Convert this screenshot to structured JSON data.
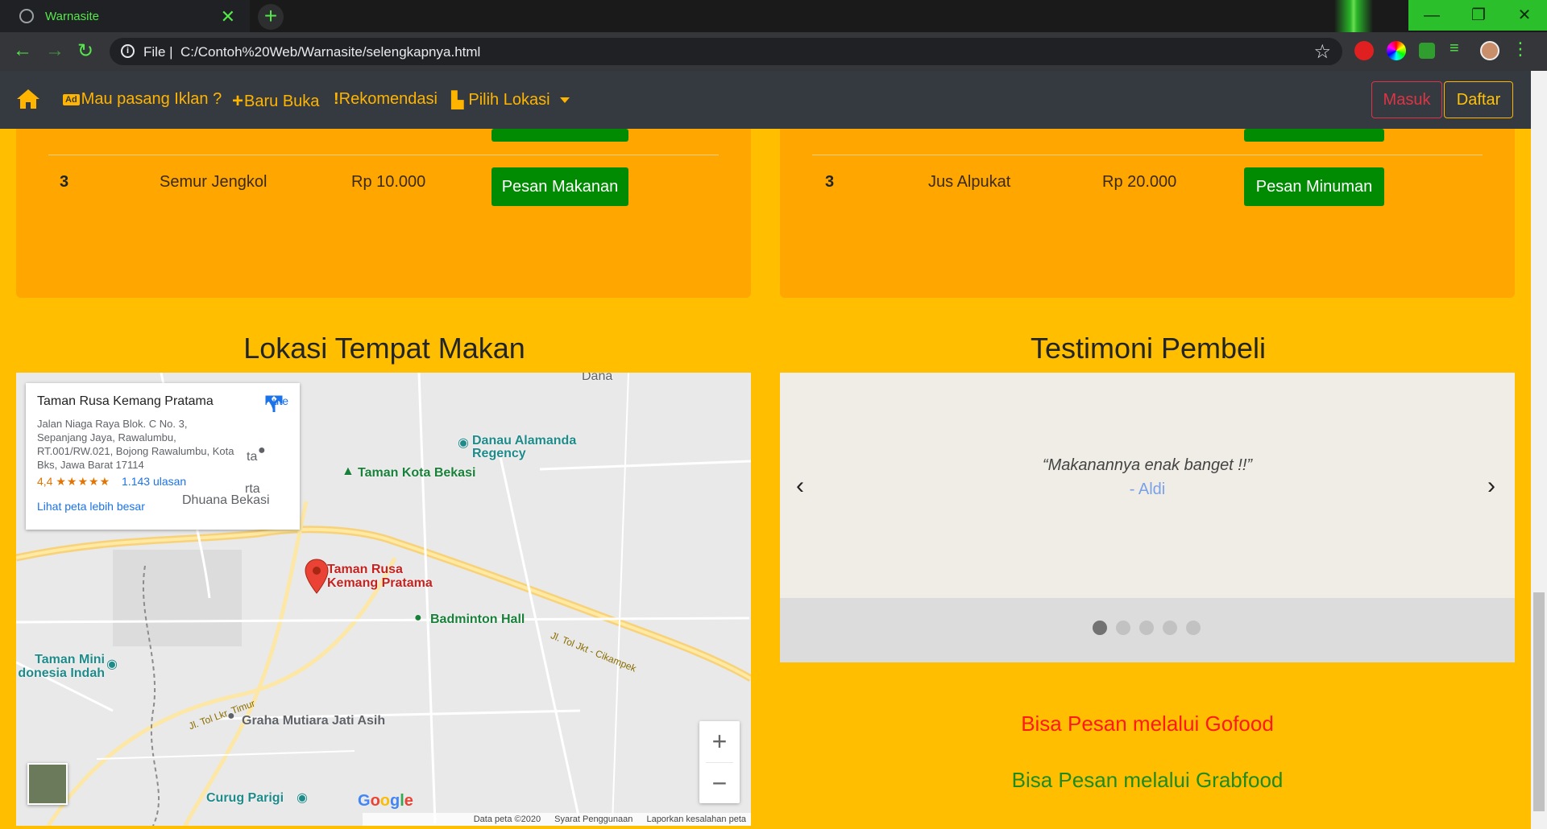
{
  "browser": {
    "tab_title": "Warnasite",
    "tab_close": "✕",
    "new_tab": "+",
    "scheme": "File  |",
    "url": "C:/Contoh%20Web/Warnasite/selengkapnya.html",
    "window_buttons": [
      "—",
      "❐",
      "✕"
    ]
  },
  "navbar": {
    "ad_badge": "Ad",
    "items": [
      "Mau pasang Iklan ?",
      "Baru Buka",
      "Rekomendasi",
      "Pilih Lokasi"
    ],
    "masuk": "Masuk",
    "daftar": "Daftar"
  },
  "food_menu": {
    "rows": [
      {
        "no": "3",
        "name": "Semur Jengkol",
        "price": "Rp 10.000",
        "button": "Pesan Makanan"
      }
    ],
    "partial_button": "Pesan Makanan"
  },
  "drink_menu": {
    "rows": [
      {
        "no": "3",
        "name": "Jus Alpukat",
        "price": "Rp 20.000",
        "button": "Pesan Minuman"
      }
    ],
    "partial_button": "Pesan Minuman"
  },
  "location": {
    "title": "Lokasi Tempat Makan",
    "map": {
      "place_name": "Taman Rusa Kemang Pratama",
      "address": "Jalan Niaga Raya Blok. C No. 3, Sepanjang Jaya, Rawalumbu, RT.001/RW.021, Bojong Rawalumbu, Kota Bks, Jawa Barat 17114",
      "rating": "4,4",
      "stars": "★★★★★",
      "reviews": "1.143 ulasan",
      "bigger_map": "Lihat peta lebih besar",
      "route": "Rute",
      "labels": {
        "danau": "Danau Alamanda Regency",
        "taman_kota": "Taman Kota Bekasi",
        "marker": "Taman Rusa Kemang Pratama",
        "badminton": "Badminton Hall",
        "taman_mini": "Taman Mini donesia Indah",
        "graha": "Graha Mutiara Jati Asih",
        "curug": "Curug Parigi",
        "dana": "Dana",
        "ta": "ta",
        "rta": "rta",
        "bhuana": "Dhuana Bekasi",
        "road1": "Jl. Tol Jkt - Cikampek",
        "road2": "Jl. Tol Lkr. Timur"
      },
      "google": "Google",
      "zoom_in": "+",
      "zoom_out": "−",
      "attribution": [
        "Data peta ©2020",
        "Syarat Penggunaan",
        "Laporkan kesalahan peta"
      ]
    }
  },
  "testimonial": {
    "title": "Testimoni Pembeli",
    "quote": "“Makanannya enak banget !!”",
    "author": "- Aldi",
    "prev": "‹",
    "next": "›",
    "active_slide": 1,
    "slide_count": 5
  },
  "order": {
    "gofood": "Bisa Pesan melalui Gofood",
    "grabfood": "Bisa Pesan melalui Grabfood",
    "gofood_color": "#ff1a1a",
    "grabfood_color": "#1f8a1f"
  },
  "colors": {
    "page_bg": "#ffbf00",
    "card_bg": "#ffa600",
    "navbar_bg": "#343a40",
    "accent": "#ffb400",
    "button_green": "#008b02"
  }
}
